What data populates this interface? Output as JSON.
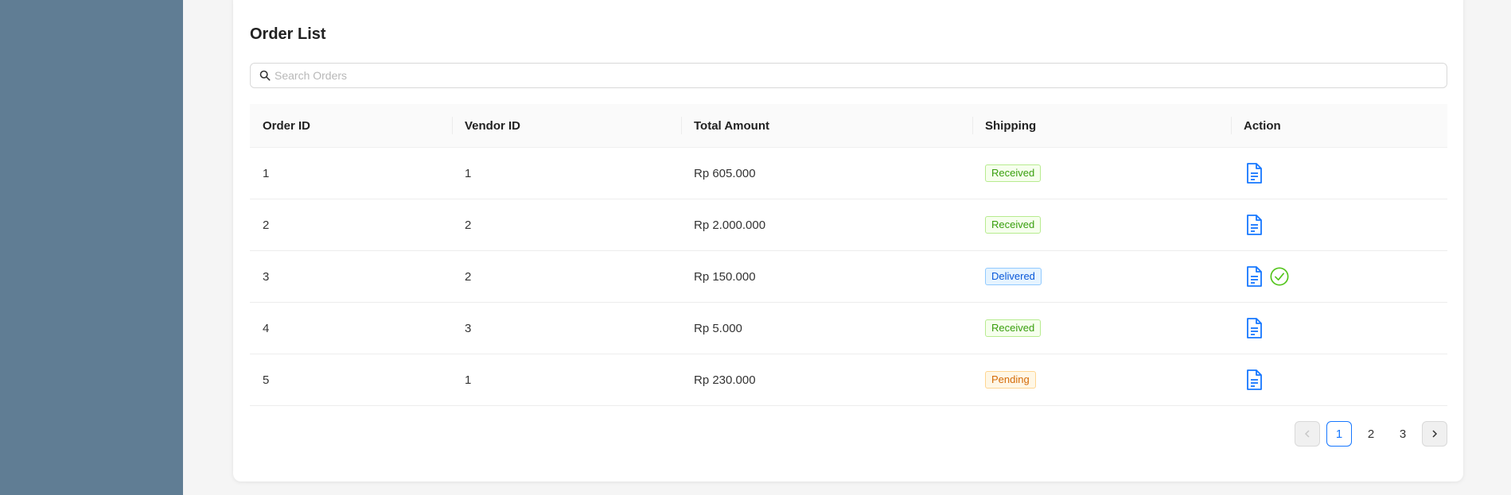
{
  "page": {
    "title": "Order List"
  },
  "search": {
    "placeholder": "Search Orders",
    "icon": "search-icon"
  },
  "table": {
    "headers": [
      "Order ID",
      "Vendor ID",
      "Total Amount",
      "Shipping",
      "Action"
    ],
    "rows": [
      {
        "order_id": "1",
        "vendor_id": "1",
        "total": "Rp 605.000",
        "shipping": "Received",
        "status": "received",
        "actions": [
          "document-icon"
        ]
      },
      {
        "order_id": "2",
        "vendor_id": "2",
        "total": "Rp 2.000.000",
        "shipping": "Received",
        "status": "received",
        "actions": [
          "document-icon"
        ]
      },
      {
        "order_id": "3",
        "vendor_id": "2",
        "total": "Rp 150.000",
        "shipping": "Delivered",
        "status": "delivered",
        "actions": [
          "document-icon",
          "check-circle-icon"
        ]
      },
      {
        "order_id": "4",
        "vendor_id": "3",
        "total": "Rp 5.000",
        "shipping": "Received",
        "status": "received",
        "actions": [
          "document-icon"
        ]
      },
      {
        "order_id": "5",
        "vendor_id": "1",
        "total": "Rp 230.000",
        "shipping": "Pending",
        "status": "pending",
        "actions": [
          "document-icon"
        ]
      }
    ]
  },
  "pagination": {
    "pages": [
      "1",
      "2",
      "3"
    ],
    "current": "1",
    "prev_icon": "chevron-left-icon",
    "next_icon": "chevron-right-icon"
  },
  "colors": {
    "sidebar": "#607d94",
    "accent": "#1677ff",
    "success": "#52c41a"
  }
}
